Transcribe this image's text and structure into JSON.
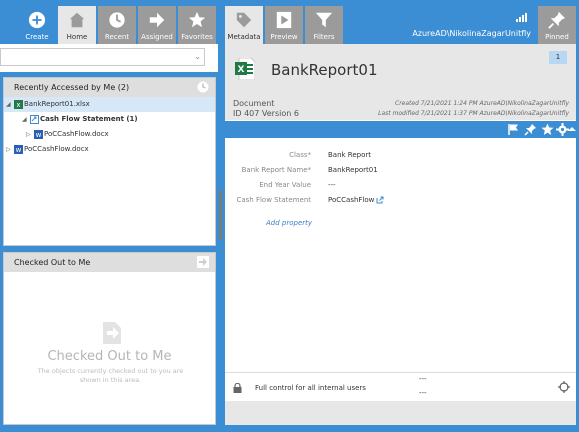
{
  "toolbar": {
    "create_label": "Create",
    "tabs": [
      {
        "label": "Home"
      },
      {
        "label": "Recent"
      },
      {
        "label": "Assigned"
      },
      {
        "label": "Favorites"
      }
    ],
    "right_tabs": [
      {
        "label": "Metadata"
      },
      {
        "label": "Preview"
      },
      {
        "label": "Filters"
      }
    ],
    "user": "AzureAD\\NikolinaZagarUnitfly",
    "pinned_label": "Pinned"
  },
  "recent": {
    "header": "Recently Accessed by Me (2)",
    "items": [
      {
        "label": "BankReport01.xlsx"
      },
      {
        "label": "Cash Flow Statement (1)"
      },
      {
        "label": "PoCCashFlow.docx"
      },
      {
        "label": "PoCCashFlow.docx"
      }
    ]
  },
  "checked_out": {
    "header": "Checked Out to Me",
    "title": "Checked Out to Me",
    "description": "The objects currently checked out to you are shown in this area."
  },
  "document": {
    "title": "BankReport01",
    "comment_count": "1",
    "type": "Document",
    "id_version": "ID 407  Version 6",
    "created": "Created 7/21/2021 1:24 PM AzureAD\\NikolinaZagarUnitfly",
    "modified": "Last modified 7/21/2021 1:37 PM AzureAD\\NikolinaZagarUnitfly"
  },
  "properties": [
    {
      "label": "Class*",
      "value": "Bank Report"
    },
    {
      "label": "Bank Report Name*",
      "value": "BankReport01"
    },
    {
      "label": "End Year Value",
      "value": "---"
    },
    {
      "label": "Cash Flow Statement",
      "value": "PoCCashFlow"
    }
  ],
  "add_property": "Add property",
  "permissions": {
    "text": "Full control for all internal users",
    "dash1": "---",
    "dash2": "---"
  },
  "colors": {
    "accent": "#3b8ed4",
    "excel_green": "#1f7a45",
    "word_blue": "#2b5fb4"
  },
  "icons": [
    "plus-circle-icon",
    "home-icon",
    "clock-icon",
    "arrow-right-icon",
    "star-icon",
    "tag-icon",
    "play-icon",
    "filter-icon",
    "signal-icon",
    "pin-icon",
    "flag-icon",
    "gear-icon",
    "chevron-up-icon",
    "lock-icon",
    "target-icon",
    "external-link-icon"
  ]
}
